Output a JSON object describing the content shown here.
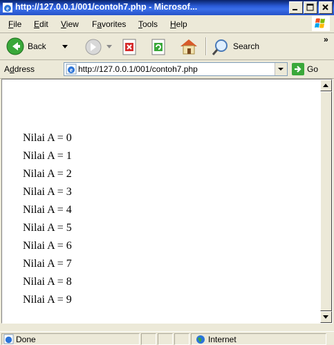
{
  "window": {
    "title": "http://127.0.0.1/001/contoh7.php - Microsof..."
  },
  "menu": {
    "items": [
      {
        "pre": "",
        "u": "F",
        "post": "ile"
      },
      {
        "pre": "",
        "u": "E",
        "post": "dit"
      },
      {
        "pre": "",
        "u": "V",
        "post": "iew"
      },
      {
        "pre": "F",
        "u": "a",
        "post": "vorites"
      },
      {
        "pre": "",
        "u": "T",
        "post": "ools"
      },
      {
        "pre": "",
        "u": "H",
        "post": "elp"
      }
    ]
  },
  "toolbar": {
    "back_label": "Back",
    "search_label": "Search",
    "overflow": "»"
  },
  "address": {
    "label_pre": "A",
    "label_u": "d",
    "label_post": "dress",
    "url": "http://127.0.0.1/001/contoh7.php",
    "go_label": "Go"
  },
  "page": {
    "lines": [
      "Nilai A = 0",
      "Nilai A = 1",
      "Nilai A = 2",
      "Nilai A = 3",
      "Nilai A = 4",
      "Nilai A = 5",
      "Nilai A = 6",
      "Nilai A = 7",
      "Nilai A = 8",
      "Nilai A = 9"
    ]
  },
  "status": {
    "text": "Done",
    "zone": "Internet"
  },
  "colors": {
    "titlebar": "#0a246a",
    "chrome": "#ece9d8",
    "go_green": "#3aa83a"
  },
  "icons": [
    "ie-icon",
    "minimize-icon",
    "maximize-icon",
    "close-icon",
    "windows-logo-icon",
    "back-arrow-icon",
    "forward-arrow-icon",
    "stop-icon",
    "refresh-icon",
    "home-icon",
    "search-icon",
    "page-icon",
    "dropdown-arrow-icon",
    "go-arrow-icon",
    "globe-icon"
  ]
}
